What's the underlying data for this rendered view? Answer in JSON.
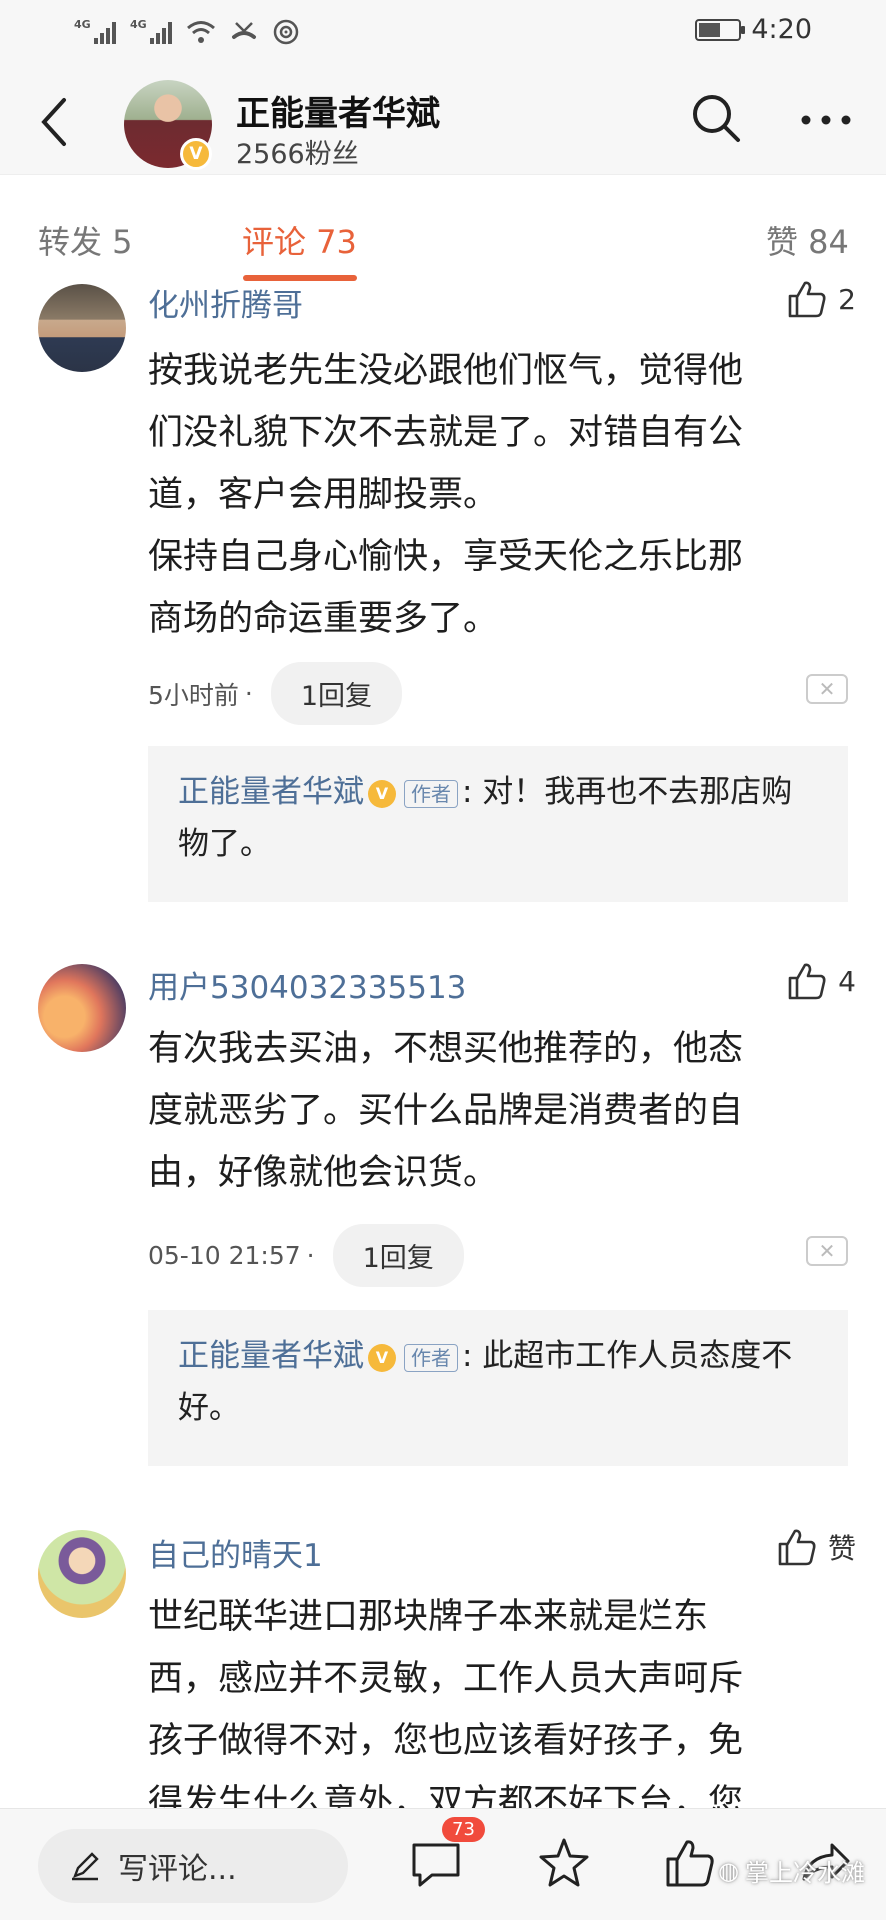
{
  "status_bar": {
    "signal1": "4G",
    "signal2": "4G",
    "time": "4:20",
    "battery_level": 0.55
  },
  "header": {
    "author_name": "正能量者华斌",
    "fans": "2566粉丝",
    "verified_mark": "V"
  },
  "tabs": [
    {
      "label": "转发 5"
    },
    {
      "label": "评论 73"
    },
    {
      "label": "赞 84"
    }
  ],
  "comments": [
    {
      "user": "化州折腾哥",
      "likes": "2",
      "text": "按我说老先生没必跟他们怄气，觉得他\n们没礼貌下次不去就是了。对错自有公\n道，客户会用脚投票。\n保持自己身心愉快，享受天伦之乐比那\n商场的命运重要多了。",
      "time": "5小时前",
      "dot": "·",
      "reply_count": "1回复",
      "reply": {
        "name": "正能量者华斌",
        "tag": "作者",
        "text": ": 对！我再也不去那店购物了。"
      }
    },
    {
      "user": "用户5304032335513",
      "likes": "4",
      "text": "有次我去买油，不想买他推荐的，他态\n度就恶劣了。买什么品牌是消费者的自\n由，好像就他会识货。",
      "time": "05-10 21:57",
      "dot": "·",
      "reply_count": "1回复",
      "reply": {
        "name": "正能量者华斌",
        "tag": "作者",
        "text": ": 此超市工作人员态度不好。"
      }
    },
    {
      "user": "自己的晴天1",
      "likes": "赞",
      "text": "世纪联华进口那块牌子本来就是烂东\n西，感应并不灵敏，工作人员大声呵斥\n孩子做得不对，您也应该看好孩子，免\n得发生什么意外，双方都不好下台，您"
    }
  ],
  "bottom_bar": {
    "write_placeholder": "写评论...",
    "comment_badge": "73",
    "watermark": "掌上冷水滩"
  },
  "colors": {
    "accent": "#e8623a",
    "link": "#4e6f97",
    "verified": "#f6b93b",
    "badge": "#f14b3c"
  }
}
